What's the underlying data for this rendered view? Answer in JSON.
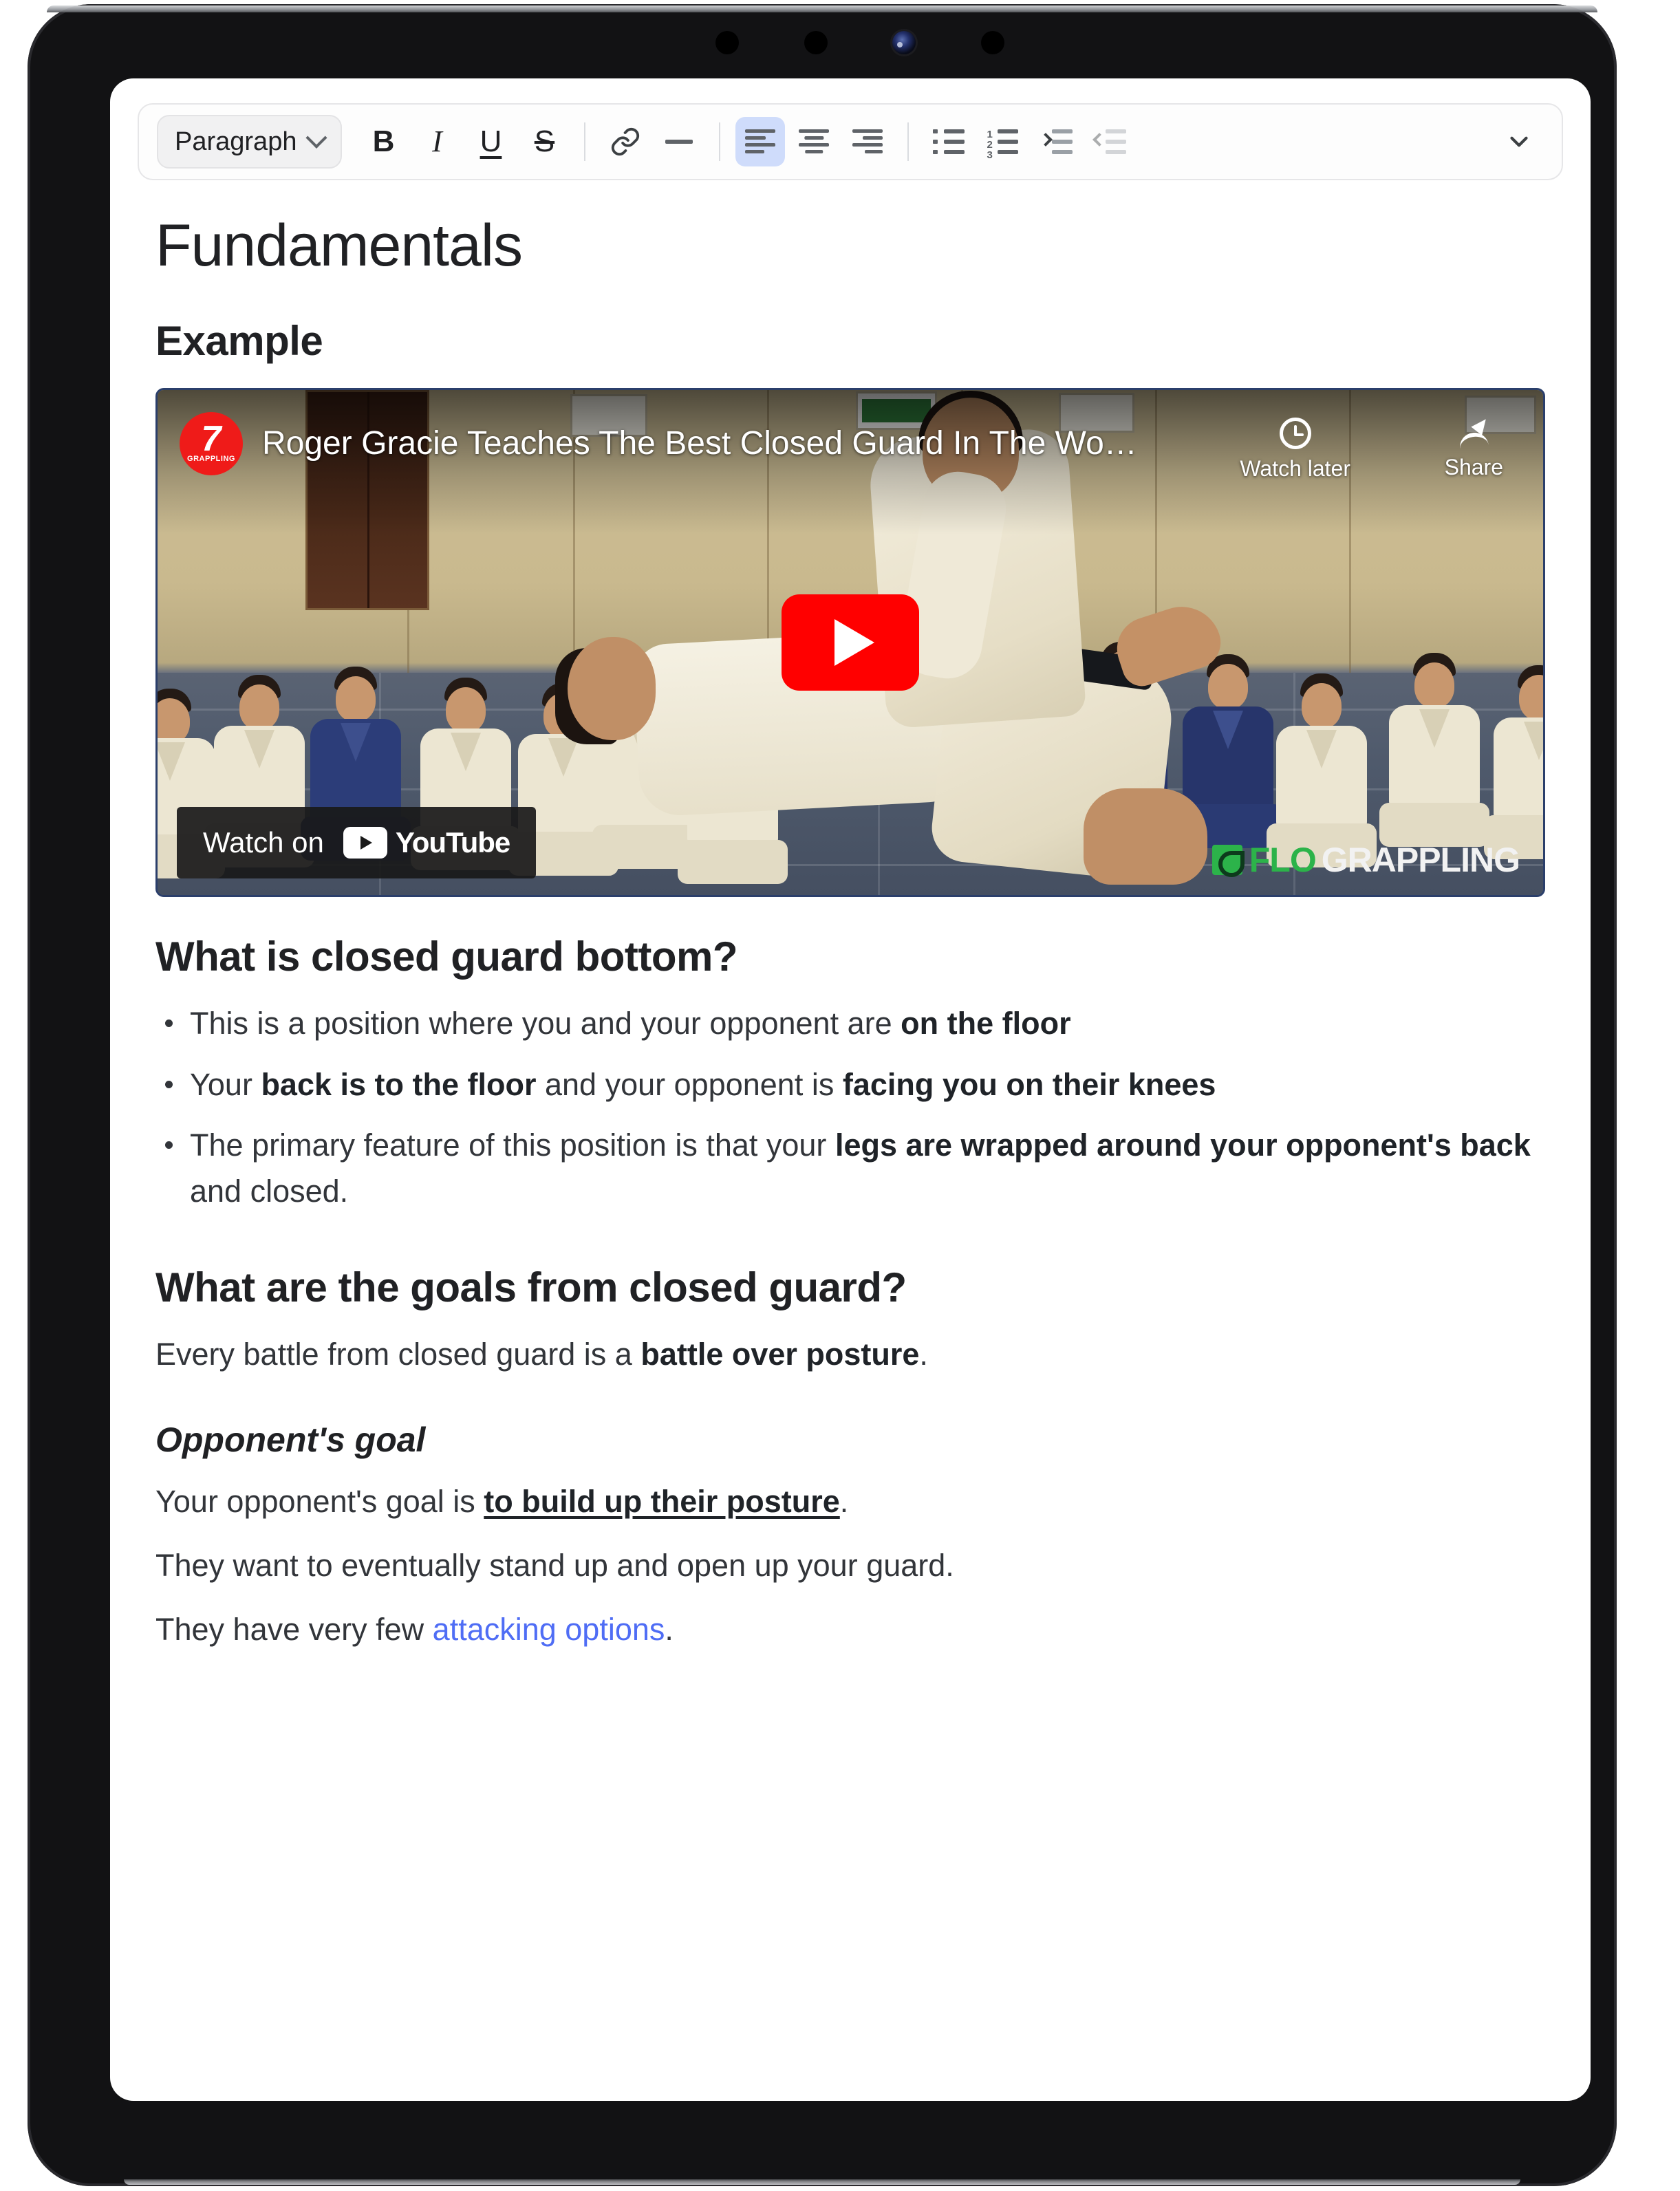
{
  "device": {
    "sensors": [
      "sensor-dot",
      "sensor-dot",
      "front-camera",
      "sensor-dot"
    ]
  },
  "toolbar": {
    "block_format": "Paragraph",
    "buttons": [
      {
        "name": "bold",
        "label": "B",
        "icon": "bold-icon"
      },
      {
        "name": "italic",
        "label": "I",
        "icon": "italic-icon"
      },
      {
        "name": "underline",
        "label": "U",
        "icon": "underline-icon"
      },
      {
        "name": "strike",
        "label": "S",
        "icon": "strikethrough-icon"
      },
      {
        "name": "link",
        "label": "",
        "icon": "link-icon"
      },
      {
        "name": "horizontal-rule",
        "label": "",
        "icon": "horizontal-rule-icon"
      },
      {
        "name": "align-left",
        "label": "",
        "icon": "align-left-icon",
        "active": true
      },
      {
        "name": "align-center",
        "label": "",
        "icon": "align-center-icon"
      },
      {
        "name": "align-right",
        "label": "",
        "icon": "align-right-icon"
      },
      {
        "name": "bullet-list",
        "label": "",
        "icon": "bullet-list-icon"
      },
      {
        "name": "numbered-list",
        "label": "",
        "icon": "numbered-list-icon"
      },
      {
        "name": "indent",
        "label": "",
        "icon": "indent-icon"
      },
      {
        "name": "outdent",
        "label": "",
        "icon": "outdent-icon",
        "disabled": true
      },
      {
        "name": "more",
        "label": "",
        "icon": "chevron-down-icon"
      }
    ],
    "numbered_marks": [
      "1",
      "2",
      "3"
    ],
    "active_accent": "#cfdcfb"
  },
  "document": {
    "title": "Fundamentals",
    "example_heading": "Example",
    "section_1": {
      "heading": "What is closed guard bottom?",
      "bullets": [
        {
          "plain_1": "This is a position where you and your opponent are ",
          "bold_1": "on the floor",
          "plain_2": ""
        },
        {
          "plain_1": "Your ",
          "bold_1": "back is to the floor",
          "plain_2": " and your opponent is ",
          "bold_2": "facing you on their knees"
        },
        {
          "plain_1": "The primary feature of this position is that your ",
          "bold_1": "legs are wrapped around your opponent's back",
          "plain_2": " and closed."
        }
      ]
    },
    "section_2": {
      "heading": "What are the goals from closed guard?",
      "intro_plain_1": "Every battle from closed guard is a ",
      "intro_bold": "battle over posture",
      "intro_plain_2": ".",
      "subheading": "Opponent's goal",
      "line_1_plain_1": "Your opponent's goal is ",
      "line_1_bold_underline": "to build up their posture",
      "line_1_plain_2": ".",
      "line_2": "They want to eventually stand up and open up your guard.",
      "line_3_plain_1": "They have very few ",
      "line_3_link": "attacking options",
      "line_3_plain_2": "."
    }
  },
  "video": {
    "title": "Roger Gracie Teaches The Best Closed Guard In The Wo…",
    "channel_avatar": "flograppling-logo",
    "avatar_mark": "7",
    "avatar_sub": "GRAPPLING",
    "watch_later_label": "Watch later",
    "share_label": "Share",
    "play_label": "play-button",
    "watch_on_label": "Watch on",
    "youtube_wordmark": "YouTube",
    "watermark_flo": "FLO",
    "watermark_grappling": "GRAPPLING",
    "colors": {
      "youtube_red": "#ff0000",
      "flo_green": "#2cb34a",
      "link_blue": "#4f6df5"
    }
  }
}
